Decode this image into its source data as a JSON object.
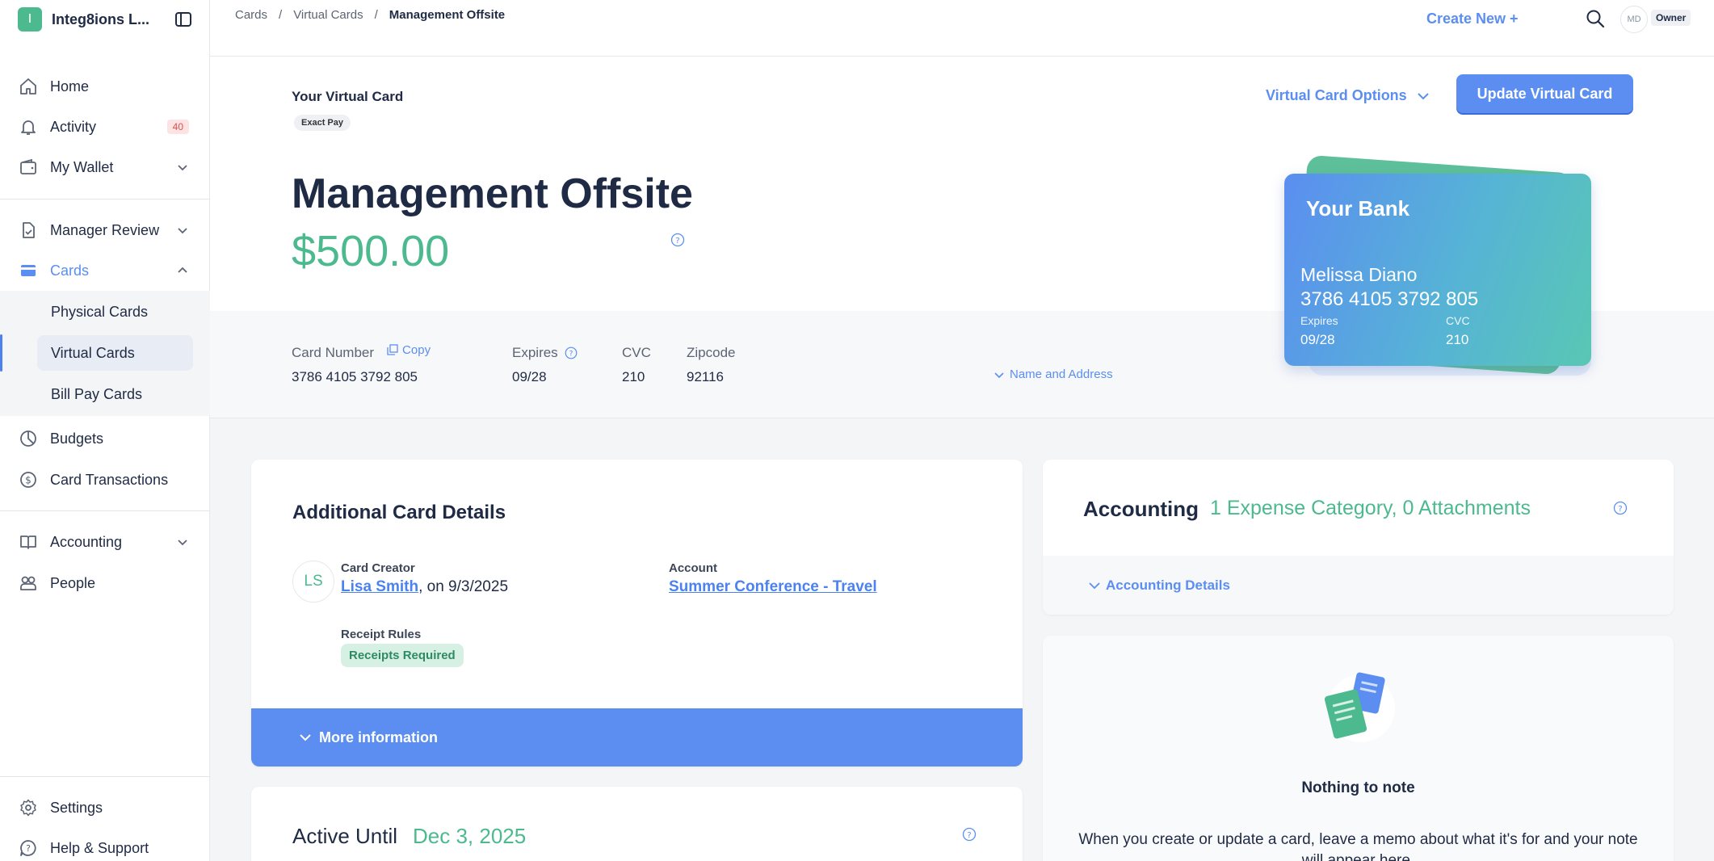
{
  "org": {
    "initial": "I",
    "name": "Integ8ions L..."
  },
  "sidebar": {
    "items": [
      {
        "label": "Home"
      },
      {
        "label": "Activity",
        "badge": "40"
      },
      {
        "label": "My Wallet"
      },
      {
        "label": "Manager Review"
      },
      {
        "label": "Cards"
      },
      {
        "label": "Budgets"
      },
      {
        "label": "Card Transactions"
      },
      {
        "label": "Accounting"
      },
      {
        "label": "People"
      },
      {
        "label": "Settings"
      },
      {
        "label": "Help & Support"
      }
    ],
    "card_sub": [
      {
        "label": "Physical Cards"
      },
      {
        "label": "Virtual Cards"
      },
      {
        "label": "Bill Pay Cards"
      }
    ]
  },
  "breadcrumb": {
    "c1": "Cards",
    "c2": "Virtual Cards",
    "current": "Management Offsite",
    "sep": "/"
  },
  "topbar": {
    "create_new": "Create New +",
    "avatar_initials": "MD",
    "role": "Owner"
  },
  "card": {
    "section_label": "Your Virtual Card",
    "type_pill": "Exact Pay",
    "title": "Management Offsite",
    "amount": "$500.00",
    "options_label": "Virtual Card Options",
    "update_label": "Update Virtual Card",
    "fields": {
      "number_label": "Card Number",
      "number": "3786 4105 3792 805",
      "copy": "Copy",
      "expires_label": "Expires",
      "expires": "09/28",
      "cvc_label": "CVC",
      "cvc": "210",
      "zip_label": "Zipcode",
      "zip": "92116",
      "name_address": "Name and Address"
    },
    "visual": {
      "bank": "Your Bank",
      "holder": "Melissa Diano",
      "number": "3786 4105 3792 805",
      "exp_label": "Expires",
      "exp": "09/28",
      "cvc_label": "CVC",
      "cvc": "210"
    }
  },
  "details": {
    "title": "Additional Card Details",
    "creator_initials": "LS",
    "creator_label": "Card Creator",
    "creator_name": "Lisa Smith",
    "creator_date": ", on 9/3/2025",
    "account_label": "Account",
    "account": "Summer Conference - Travel",
    "receipt_label": "Receipt Rules",
    "receipt_pill": "Receipts Required",
    "more_info": "More information"
  },
  "active_until": {
    "label": "Active Until",
    "date": "Dec 3, 2025"
  },
  "accounting": {
    "title": "Accounting",
    "summary": "1 Expense Category, 0 Attachments",
    "details_link": "Accounting Details"
  },
  "notes": {
    "title": "Nothing to note",
    "body": "When you create or update a card, leave a memo about what it's for and your note will appear here."
  },
  "colors": {
    "accent": "#5b8ef0",
    "green": "#4cb98f",
    "ink": "#1f2a44"
  }
}
